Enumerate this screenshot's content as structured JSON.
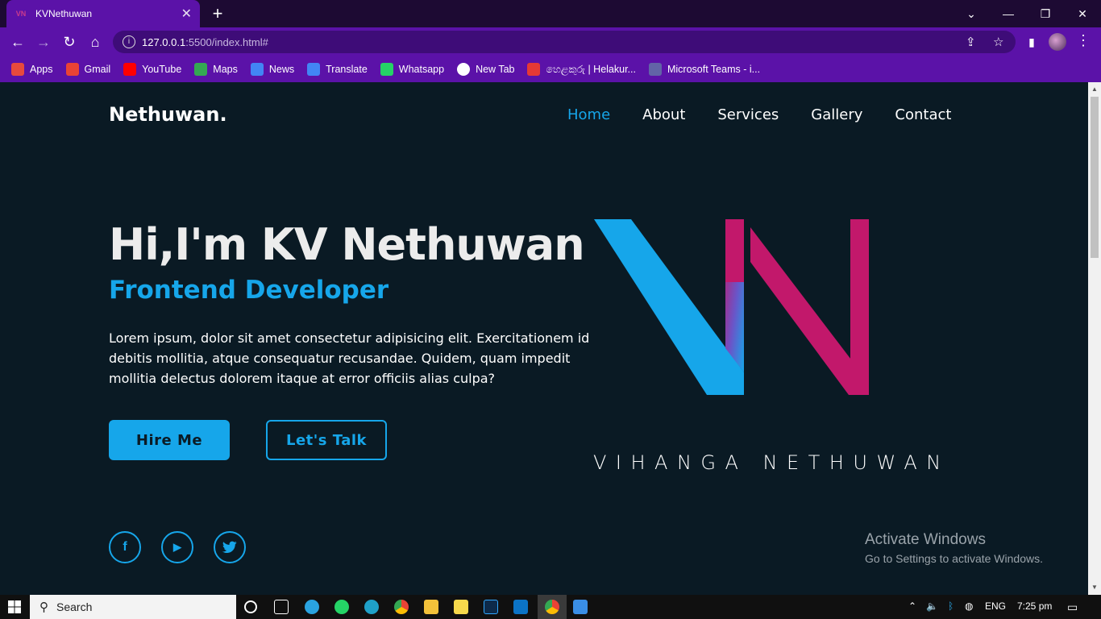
{
  "browser": {
    "tab_title": "KVNethuwan",
    "tab_favicon": "VN",
    "tab_close": "✕",
    "new_tab": "+",
    "url_host": "127.0.0.1",
    "url_path": ":5500/index.html#",
    "bookmarks": [
      {
        "label": "Apps",
        "icon": "apps-grid-icon",
        "color": "#e84a3c"
      },
      {
        "label": "Gmail",
        "icon": "gmail-icon",
        "color": "#ea4335"
      },
      {
        "label": "YouTube",
        "icon": "youtube-icon",
        "color": "#ff0000"
      },
      {
        "label": "Maps",
        "icon": "maps-icon",
        "color": "#34a853"
      },
      {
        "label": "News",
        "icon": "news-icon",
        "color": "#4285f4"
      },
      {
        "label": "Translate",
        "icon": "translate-icon",
        "color": "#4285f4"
      },
      {
        "label": "Whatsapp",
        "icon": "whatsapp-icon",
        "color": "#25d366"
      },
      {
        "label": "New Tab",
        "icon": "globe-icon",
        "color": "#ffffff"
      },
      {
        "label": "හෙළකුරු | Helakur...",
        "icon": "helakuru-icon",
        "color": "#e53935"
      },
      {
        "label": "Microsoft Teams - i...",
        "icon": "teams-icon",
        "color": "#6264a7"
      }
    ]
  },
  "site": {
    "logo": "Nethuwan.",
    "nav": [
      "Home",
      "About",
      "Services",
      "Gallery",
      "Contact"
    ],
    "active_nav": "Home",
    "hero_title": "Hi,I'm KV Nethuwan",
    "hero_subtitle": "Frontend Developer",
    "hero_text": "Lorem ipsum, dolor sit amet consectetur adipisicing elit. Exercitationem id debitis mollitia, atque consequatur recusandae. Quidem, quam impedit mollitia delectus dolorem itaque at error officiis alias culpa?",
    "btn_hire": "Hire Me",
    "btn_talk": "Let's Talk",
    "brand_name": "VIHANGA NETHUWAN",
    "social": [
      {
        "icon": "facebook-icon",
        "glyph": "f"
      },
      {
        "icon": "youtube-icon",
        "glyph": "▶"
      },
      {
        "icon": "twitter-icon",
        "glyph": "🐦"
      }
    ],
    "accent": "#16a6ea",
    "logo_pink": "#c2186b"
  },
  "watermark": {
    "line1": "Activate Windows",
    "line2": "Go to Settings to activate Windows."
  },
  "taskbar": {
    "search_placeholder": "Search",
    "lang": "ENG",
    "time": "7:25 pm"
  }
}
